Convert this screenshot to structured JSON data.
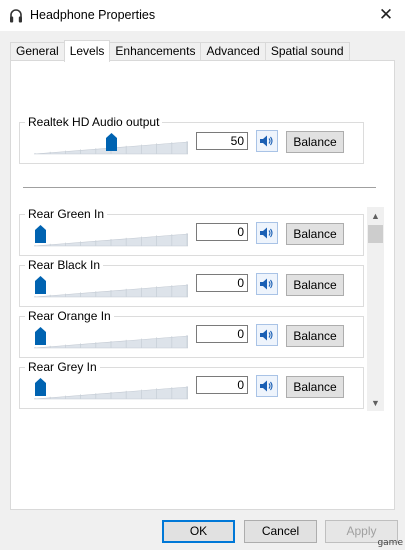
{
  "window": {
    "title": "Headphone Properties",
    "icon": "headphone-icon",
    "close_icon": "close-icon"
  },
  "tabs": [
    {
      "label": "General",
      "active": false
    },
    {
      "label": "Levels",
      "active": true
    },
    {
      "label": "Enhancements",
      "active": false
    },
    {
      "label": "Advanced",
      "active": false
    },
    {
      "label": "Spatial sound",
      "active": false
    }
  ],
  "main_output": {
    "label": "Realtek HD Audio output",
    "value": "50",
    "level": 0.5,
    "balance_label": "Balance"
  },
  "inputs": [
    {
      "label": "Rear Green In",
      "value": "0",
      "level": 0,
      "balance_label": "Balance"
    },
    {
      "label": "Rear Black In",
      "value": "0",
      "level": 0,
      "balance_label": "Balance"
    },
    {
      "label": "Rear Orange In",
      "value": "0",
      "level": 0,
      "balance_label": "Balance"
    },
    {
      "label": "Rear Grey In",
      "value": "0",
      "level": 0,
      "balance_label": "Balance"
    }
  ],
  "footer": {
    "ok": "OK",
    "cancel": "Cancel",
    "apply": "Apply"
  },
  "watermark": "game",
  "colors": {
    "accent": "#0078d7",
    "thumb": "#0063b1"
  }
}
